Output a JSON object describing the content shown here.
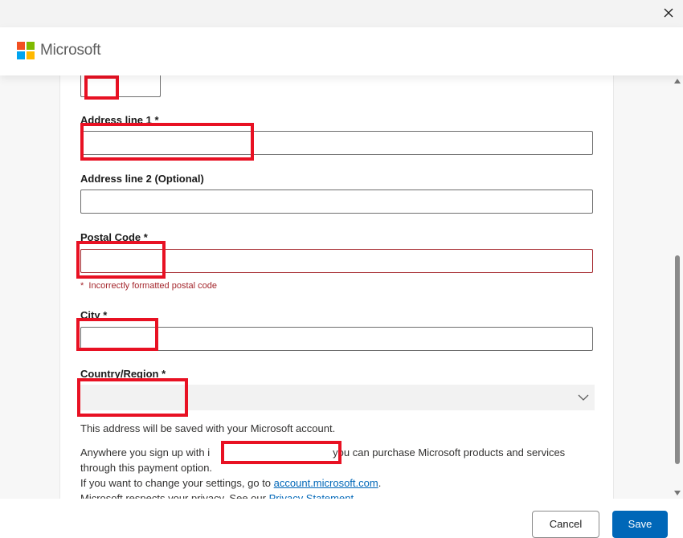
{
  "window": {
    "close_icon": "close-icon"
  },
  "header": {
    "brand": "Microsoft",
    "logo_colors": [
      "#f25022",
      "#7fba00",
      "#00a4ef",
      "#ffb900"
    ]
  },
  "form": {
    "address1_label": "Address line 1",
    "address2_label": "Address line 2 (Optional)",
    "address2_value": "",
    "postal_label": "Postal Code",
    "postal_error": "Incorrectly formatted postal code",
    "city_label": "City",
    "country_label": "Country/Region",
    "required_mark": "*",
    "error_mark": "*"
  },
  "info": {
    "saved_note": "This address will be saved with your Microsoft account.",
    "signup_prefix": "Anywhere you sign up with i",
    "signup_suffix": "you can purchase Microsoft products and services",
    "signup_line2": "through this payment option.",
    "settings_prefix": "If you want to change your settings, go to ",
    "settings_link": "account.microsoft.com",
    "settings_suffix": ".",
    "privacy_prefix": "Microsoft respects your privacy. See our ",
    "privacy_link": "Privacy Statement"
  },
  "footer": {
    "cancel_label": "Cancel",
    "save_label": "Save"
  },
  "colors": {
    "accent": "#0067b8",
    "error": "#a4262c",
    "redaction": "#e81123"
  }
}
